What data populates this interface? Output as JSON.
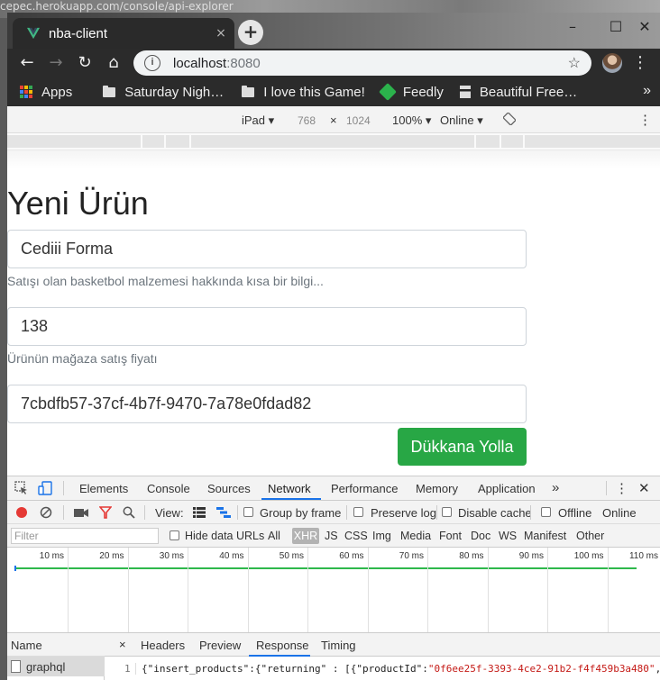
{
  "background": {
    "url_text": "cepec.herokuapp.com/console/api-explorer"
  },
  "browser": {
    "tab_title": "nba-client",
    "tab_close": "×",
    "new_tab": "+",
    "window_controls": {
      "minimize": "–",
      "maximize": "☐",
      "close": "✕"
    },
    "address": {
      "host": "localhost",
      "port": ":8080"
    },
    "bookmarks": [
      "Apps",
      "Saturday Nigh…",
      "I love this Game!",
      "Feedly",
      "Beautiful Free…"
    ],
    "bookmarks_more": "»",
    "colors": {
      "feedly": "#2bb24c",
      "vue": "#41b883"
    }
  },
  "device_toolbar": {
    "device": "iPad ▾",
    "width": "768",
    "times": "×",
    "height": "1024",
    "zoom": "100% ▾",
    "network": "Online ▾"
  },
  "page": {
    "title": "Yeni Ürün",
    "fields": [
      {
        "value": "Cediii Forma",
        "help": "Satışı olan basketbol malzemesi hakkında kısa bir bilgi..."
      },
      {
        "value": "138",
        "help": "Ürünün mağaza satış fiyatı"
      },
      {
        "value": "7cbdfb57-37cf-4b7f-9470-7a78e0fdad82",
        "help": ""
      }
    ],
    "submit_label": "Dükkana Yolla",
    "colors": {
      "submit": "#28a745"
    }
  },
  "devtools": {
    "tabs": [
      "Elements",
      "Console",
      "Sources",
      "Network",
      "Performance",
      "Memory",
      "Application"
    ],
    "active_tab": "Network",
    "more": "»",
    "network_toolbar": {
      "view_label": "View:",
      "group_by_frame": "Group by frame",
      "preserve_log": "Preserve log",
      "disable_cache": "Disable cache",
      "offline": "Offline",
      "online": "Online"
    },
    "filter": {
      "placeholder": "Filter",
      "hide_data_urls": "Hide data URLs",
      "types": [
        "All",
        "XHR",
        "JS",
        "CSS",
        "Img",
        "Media",
        "Font",
        "Doc",
        "WS",
        "Manifest",
        "Other"
      ],
      "active_type": "XHR"
    },
    "timeline_ticks": [
      "10 ms",
      "20 ms",
      "30 ms",
      "40 ms",
      "50 ms",
      "60 ms",
      "70 ms",
      "80 ms",
      "90 ms",
      "100 ms",
      "110 ms"
    ],
    "requests_header": "Name",
    "requests": [
      "graphql"
    ],
    "detail_tabs": [
      "Headers",
      "Preview",
      "Response",
      "Timing"
    ],
    "active_detail_tab": "Response",
    "detail_close": "×",
    "response": {
      "line_number": "1",
      "p1": "{\"insert_products\":{\"returning\" : [{\"productId\":",
      "p2": "\"0f6ee25f-3393-4ce2-91b2-f4f459b3a480\"",
      "p3": ",\""
    }
  }
}
